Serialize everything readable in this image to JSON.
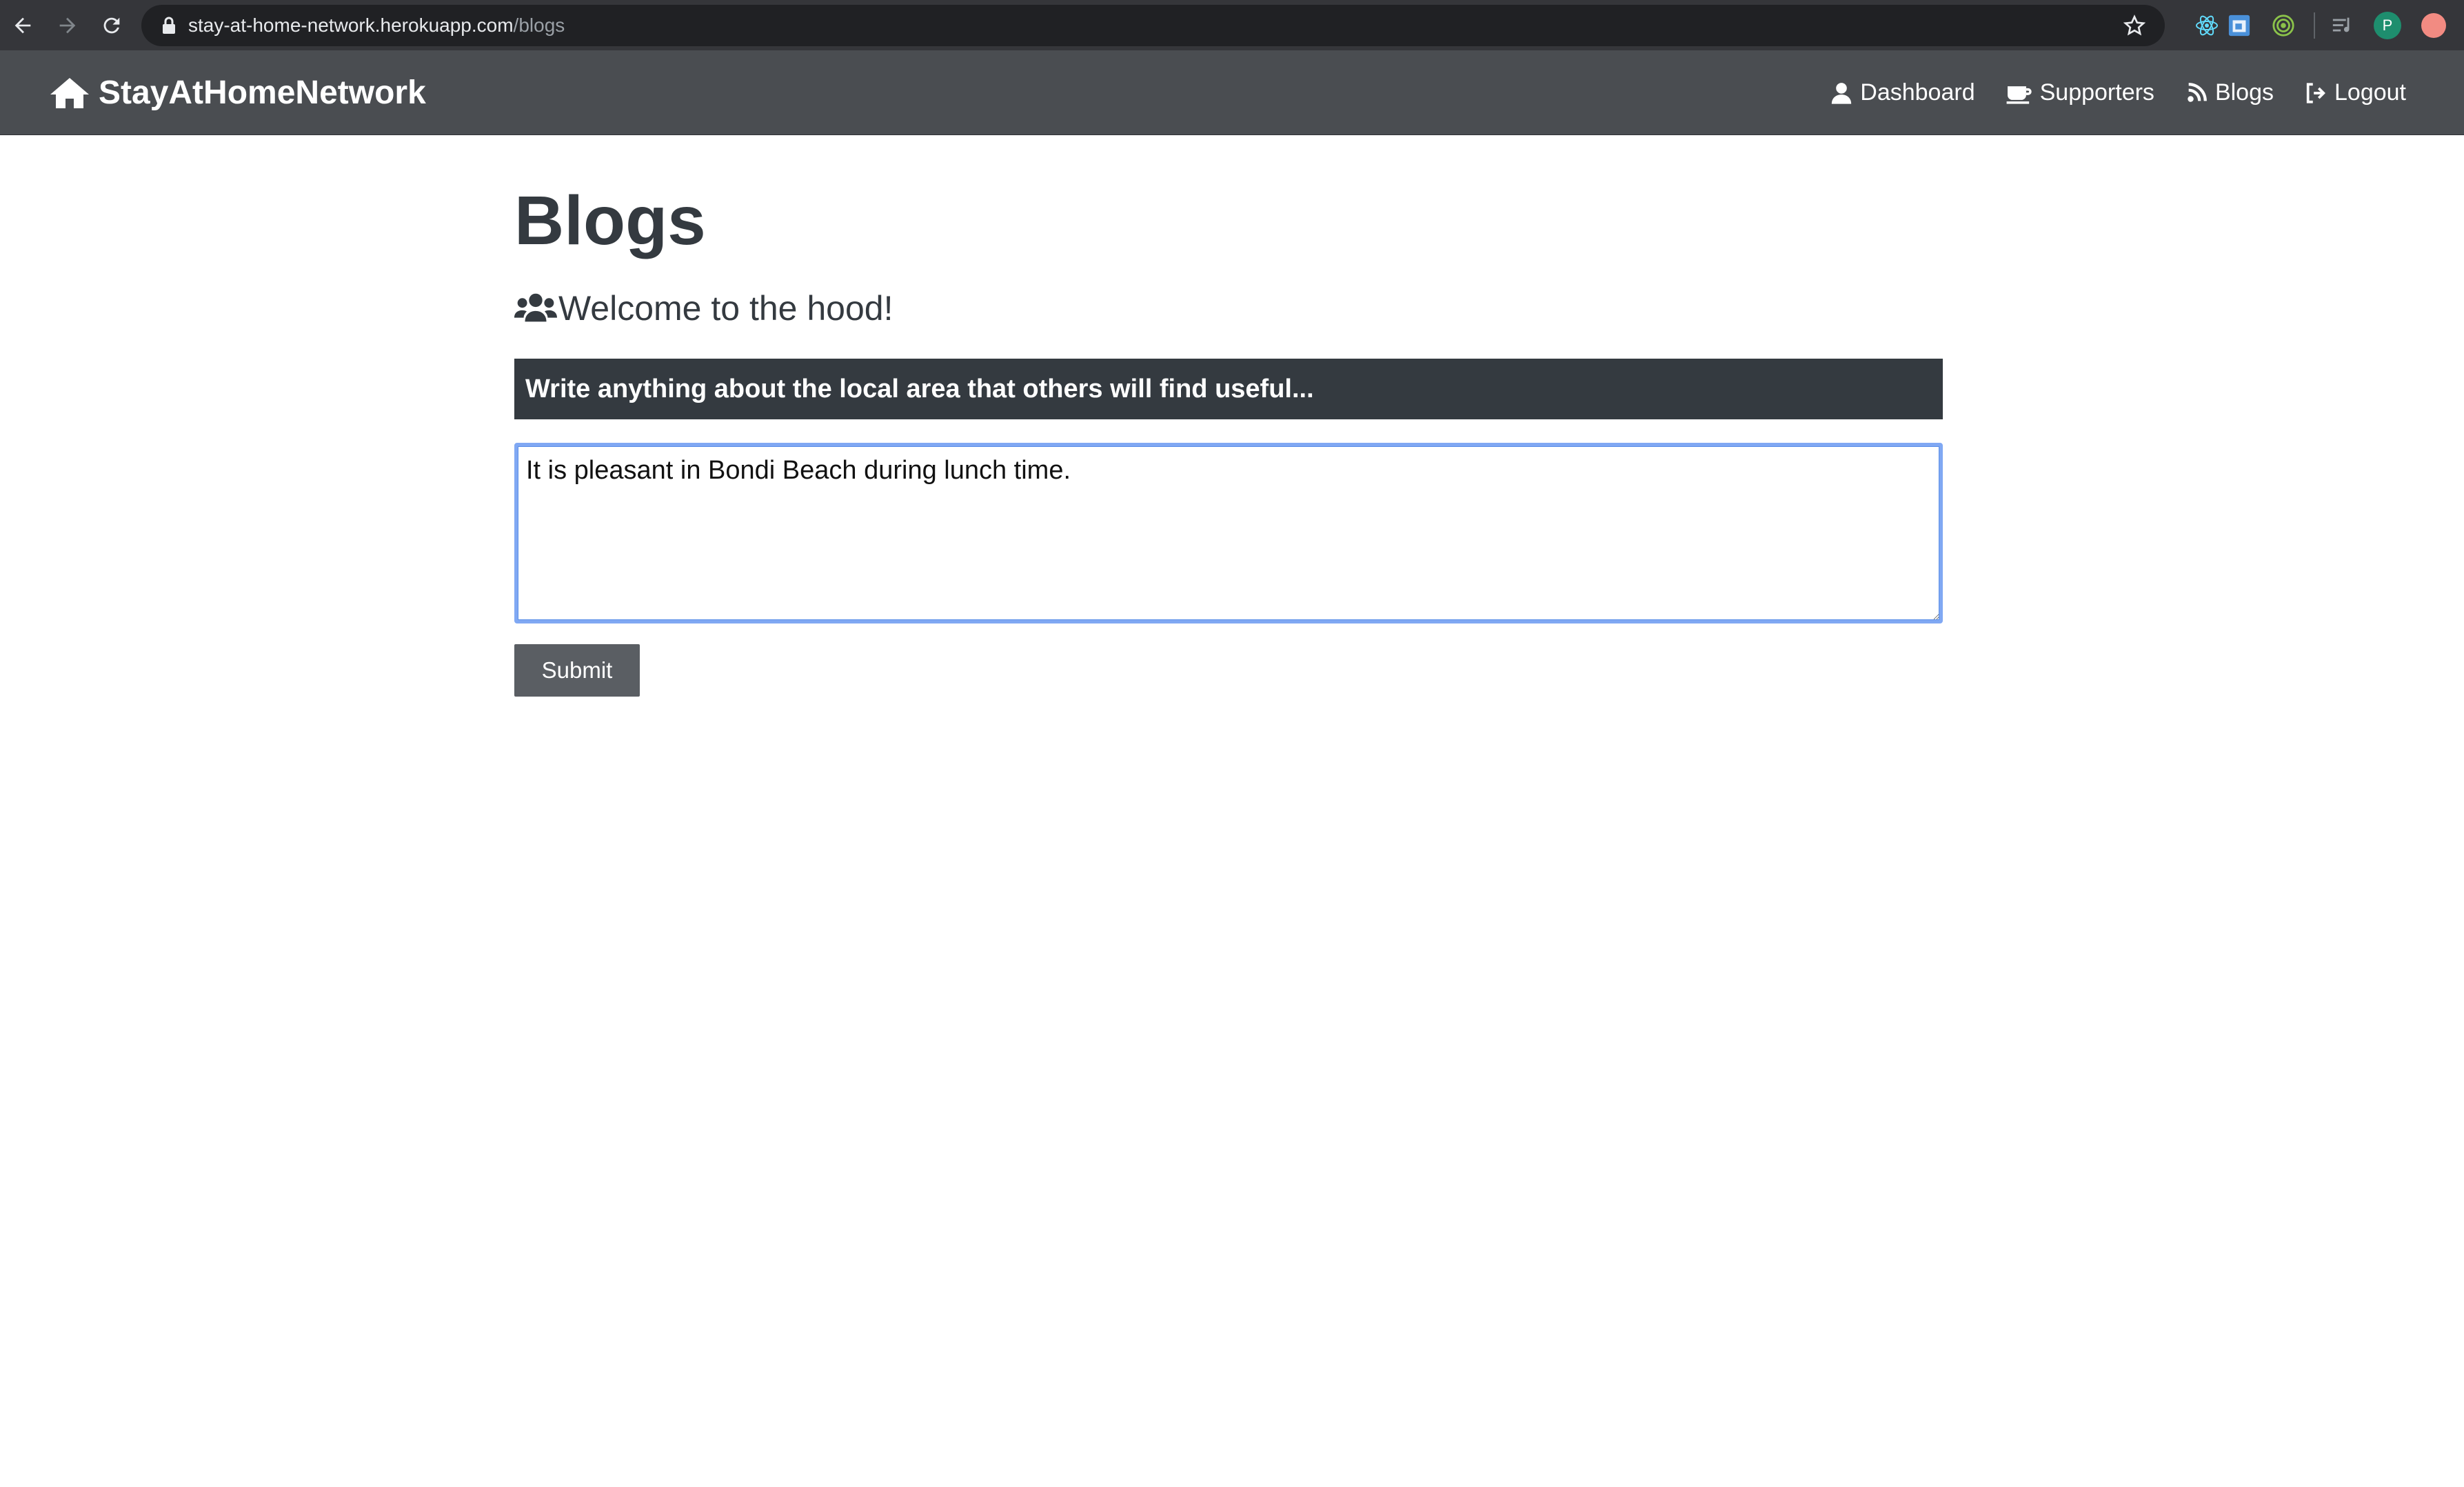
{
  "browser": {
    "url_host": "stay-at-home-network.herokuapp.com",
    "url_path": "/blogs",
    "profile_initial": "P"
  },
  "navbar": {
    "brand": "StayAtHomeNetwork",
    "links": [
      {
        "label": "Dashboard",
        "icon": "user-icon"
      },
      {
        "label": "Supporters",
        "icon": "coffee-icon"
      },
      {
        "label": "Blogs",
        "icon": "broadcast-icon"
      },
      {
        "label": "Logout",
        "icon": "sign-out-icon"
      }
    ]
  },
  "page": {
    "title": "Blogs",
    "subtitle": "Welcome to the hood!",
    "hint": "Write anything about the local area that others will find useful...",
    "textarea_value": "It is pleasant in Bondi Beach during lunch time.",
    "submit_label": "Submit"
  },
  "colors": {
    "navbar_bg": "#4a4d51",
    "hint_bg": "#343a40",
    "focus_border": "#80a8f3",
    "button_bg": "#5a5e63"
  }
}
